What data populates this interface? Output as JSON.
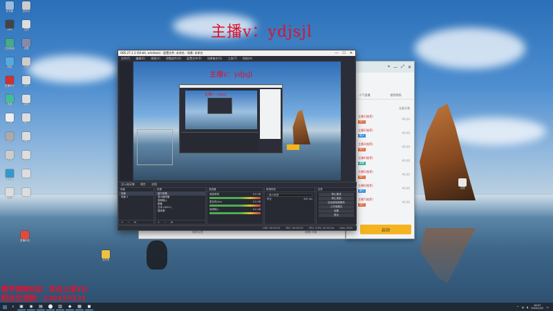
{
  "overlay": {
    "top_text": "主播v：ydjsjl",
    "bottom_line1": "教学视频B站：年迈上单YD",
    "bottom_line2": "粉丝交流群：230459531"
  },
  "desktop": {
    "icons": [
      {
        "label": "此电脑"
      },
      {
        "label": "回收站"
      },
      {
        "label": "OBS"
      },
      {
        "label": "文档"
      },
      {
        "label": "控制面板"
      },
      {
        "label": "设置"
      },
      {
        "label": "网络"
      },
      {
        "label": "应用"
      },
      {
        "label": "直播助手"
      },
      {
        "label": "文件"
      },
      {
        "label": "录屏"
      },
      {
        "label": "说明"
      },
      {
        "label": "工具"
      },
      {
        "label": "图片"
      },
      {
        "label": "软件"
      },
      {
        "label": "资料"
      },
      {
        "label": "下载"
      },
      {
        "label": "新建"
      },
      {
        "label": "浏览器"
      },
      {
        "label": ""
      },
      {
        "label": "音乐"
      },
      {
        "label": ""
      }
    ],
    "mid_icon_label": "直播伴侣",
    "folder_label": "文件夹",
    "right_icon_label": "文档"
  },
  "obs": {
    "title": "OBS 27.1.3 (64-bit, windows) - 配置文件: 未命名 - 场景: 未命名",
    "menu": [
      "文件(F)",
      "编辑(E)",
      "视图(V)",
      "停靠部件(D)",
      "配置文件(P)",
      "场景集合(S)",
      "工具(T)",
      "帮助(H)"
    ],
    "preview_caption": "主播v：ydjsjl",
    "nested_caption": "主播v：ydjsjl",
    "bar": [
      "显示器采集",
      "属性",
      "滤镜"
    ],
    "docks": {
      "scenes": {
        "title": "场景",
        "items": [
          "场景",
          "场景 2"
        ]
      },
      "sources": {
        "title": "来源",
        "items": [
          "窗口采集",
          "显示器采集",
          "音频输入",
          "图像",
          "文本 (GDI+)",
          "媒体源"
        ]
      },
      "mixer": {
        "title": "混音器",
        "channels": [
          {
            "name": "桌面音频",
            "db": "0.0 dB"
          },
          {
            "name": "麦克风/Aux",
            "db": "0.0 dB"
          },
          {
            "name": "音频输入",
            "db": "0.0 dB"
          }
        ]
      },
      "transitions": {
        "title": "转场特效",
        "type": "淡入淡出",
        "duration_label": "时长",
        "duration": "300 ms"
      },
      "controls": {
        "title": "控件",
        "buttons": [
          "停止推流",
          "停止录制",
          "启动虚拟摄像机",
          "工作室模式",
          "设置",
          "退出"
        ]
      }
    },
    "status": [
      "LIVE: 00:05:32",
      "REC: 00:05:30",
      "CPU: 3.8%, 30.00 fps",
      "kb/s: 2500"
    ]
  },
  "right_app": {
    "tabs": [
      "人气直播",
      "推荐视频"
    ],
    "filter_left": "推荐",
    "filter_right": "全部分类",
    "items": [
      {
        "name": "主播1(推荐)",
        "tag": "热门",
        "tag_color": "#e26a3a",
        "price": "¥0.00"
      },
      {
        "name": "主播2(推荐)",
        "tag": "新人",
        "tag_color": "#3a8fe2",
        "price": "¥0.00"
      },
      {
        "name": "主播3(推荐)",
        "tag": "热门",
        "tag_color": "#e26a3a",
        "price": "¥0.00"
      },
      {
        "name": "主播4(推荐)",
        "tag": "推荐",
        "tag_color": "#3ab0a0",
        "price": "¥0.00"
      },
      {
        "name": "主播5(推荐)",
        "tag": "热门",
        "tag_color": "#e26a3a",
        "price": "¥0.00"
      },
      {
        "name": "主播6(推荐)",
        "tag": "新人",
        "tag_color": "#3a8fe2",
        "price": "¥0.00"
      },
      {
        "name": "主播7(推荐)",
        "tag": "热门",
        "tag_color": "#e26a3a",
        "price": "¥0.00"
      }
    ],
    "start_label": "启动"
  },
  "under_panel": {
    "left_text": "辅助设置",
    "center_text": "直播 开始"
  },
  "taskbar": {
    "apps": [
      "▣",
      "◉",
      "▤",
      "⬤",
      "▥",
      "◆",
      "▦",
      "◼"
    ],
    "time": "16:57",
    "date": "2022/1/22"
  }
}
